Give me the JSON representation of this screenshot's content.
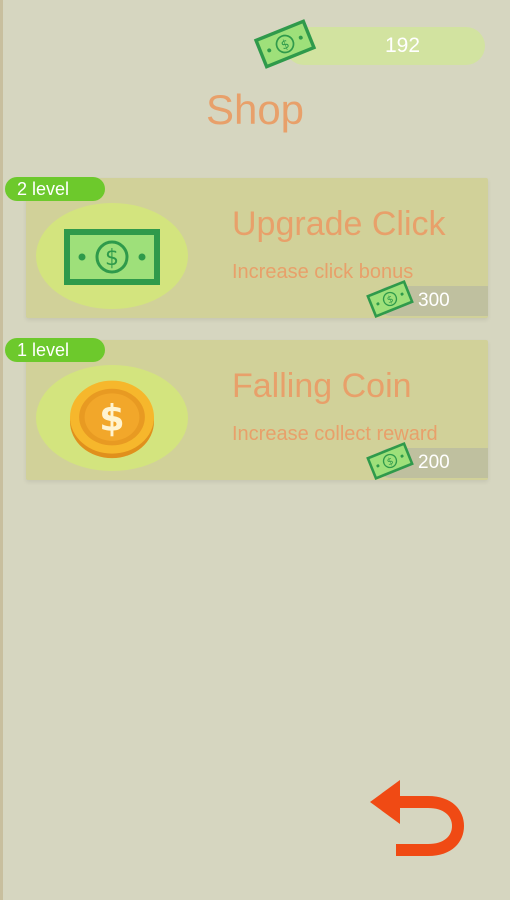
{
  "balance": {
    "value": "192",
    "icon": "banknote-icon"
  },
  "title": "Shop",
  "items": [
    {
      "level": "2 level",
      "name": "Upgrade Click",
      "description": "Increase click bonus",
      "price": "300",
      "icon": "banknote-icon"
    },
    {
      "level": "1 level",
      "name": "Falling Coin",
      "description": "Increase collect reward",
      "price": "200",
      "icon": "dollar-coin-icon"
    }
  ],
  "back_button": {
    "icon": "back-arrow-icon"
  },
  "colors": {
    "background": "#d6d6c0",
    "title": "#e8a06a",
    "card": "#d1d199",
    "badge": "#6dc92c",
    "back_arrow": "#f04a14"
  }
}
